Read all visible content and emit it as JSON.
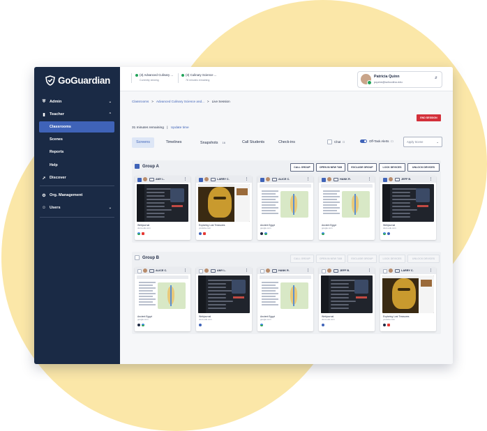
{
  "brand": {
    "name": "GoGuardian"
  },
  "sidebar": {
    "items": [
      {
        "label": "Admin",
        "icon": "shield-icon"
      },
      {
        "label": "Teacher",
        "icon": "book-icon"
      },
      {
        "label": "Discover",
        "icon": "rocket-icon"
      },
      {
        "label": "Org. Management",
        "icon": "gear-icon"
      },
      {
        "label": "Users",
        "icon": "user-icon"
      }
    ],
    "sub_items": [
      "Classrooms",
      "Scenes",
      "Reports",
      "Help"
    ],
    "active": "Classrooms"
  },
  "topbar": {
    "sessions": [
      {
        "title": "(3) Advanced Culinary ...",
        "status": "Currently viewing"
      },
      {
        "title": "(3) Culinary Science ...",
        "status": "78 minutes remaining"
      }
    ],
    "user": {
      "name": "Patricia Quinn",
      "email": "pquinn@schoolino.edu"
    }
  },
  "breadcrumb": {
    "items": [
      "Classrooms",
      "Advanced Culinary Science and...",
      "Live Session"
    ]
  },
  "session": {
    "end_label": "END SESSION",
    "remaining": "31 minutes remaining",
    "update_link": "Update time"
  },
  "tabs": [
    {
      "label": "Screens",
      "count": ""
    },
    {
      "label": "Timelines",
      "count": ""
    },
    {
      "label": "Snapshots",
      "count": "16"
    },
    {
      "label": "Call Students",
      "count": ""
    },
    {
      "label": "Check-ins",
      "count": ""
    }
  ],
  "controls": {
    "chat_label": "Chat",
    "off_task_label": "Off-Task Alerts",
    "scene_placeholder": "Apply Scene"
  },
  "groups": [
    {
      "name": "Group A",
      "buttons": [
        "CALL GROUP",
        "OPEN IN NEW TAB",
        "EXCLUDE GROUP",
        "LOCK DEVICES",
        "UNLOCK DEVICES"
      ],
      "students": [
        {
          "name": "AMY L.",
          "page": "Webjournal",
          "url": "docs.edu.com",
          "screen": "dark",
          "icons": [
            "i-g",
            "i-y"
          ]
        },
        {
          "name": "LARRY C.",
          "page": "Exploring Lost Treasures",
          "url": "youtube.com",
          "screen": "gold",
          "icons": [
            "i-b",
            "i-y"
          ]
        },
        {
          "name": "ALICE C.",
          "page": "Ancient Egypt",
          "url": "google.com",
          "screen": "map",
          "icons": [
            "i-d",
            "i-g"
          ]
        },
        {
          "name": "HANK R.",
          "page": "Ancient Egypt",
          "url": "google.com",
          "screen": "map",
          "icons": [
            "i-g"
          ]
        },
        {
          "name": "JEFF B.",
          "page": "Webjournal",
          "url": "docs.edu.com",
          "screen": "dark",
          "icons": [
            "i-g",
            "i-b"
          ]
        }
      ]
    },
    {
      "name": "Group B",
      "buttons": [
        "CALL GROUP",
        "OPEN IN NEW TAB",
        "EXCLUDE GROUP",
        "LOCK DEVICES",
        "UNLOCK DEVICES"
      ],
      "students": [
        {
          "name": "ALICE C.",
          "page": "Ancient Egypt",
          "url": "google.com",
          "screen": "map",
          "icons": [
            "i-d",
            "i-g"
          ]
        },
        {
          "name": "AMY L.",
          "page": "Webjournal",
          "url": "docs.edu.com",
          "screen": "dark",
          "icons": [
            "i-b"
          ]
        },
        {
          "name": "HANK R.",
          "page": "Ancient Egypt",
          "url": "google.com",
          "screen": "map",
          "icons": [
            "i-g"
          ]
        },
        {
          "name": "JEFF B.",
          "page": "Webjournal",
          "url": "docs.edu.com",
          "screen": "dark",
          "icons": [
            "i-b"
          ]
        },
        {
          "name": "LARRY C.",
          "page": "Exploring Lost Treasures",
          "url": "youtube.com",
          "screen": "gold",
          "icons": [
            "i-d",
            "i-y"
          ]
        }
      ]
    }
  ]
}
